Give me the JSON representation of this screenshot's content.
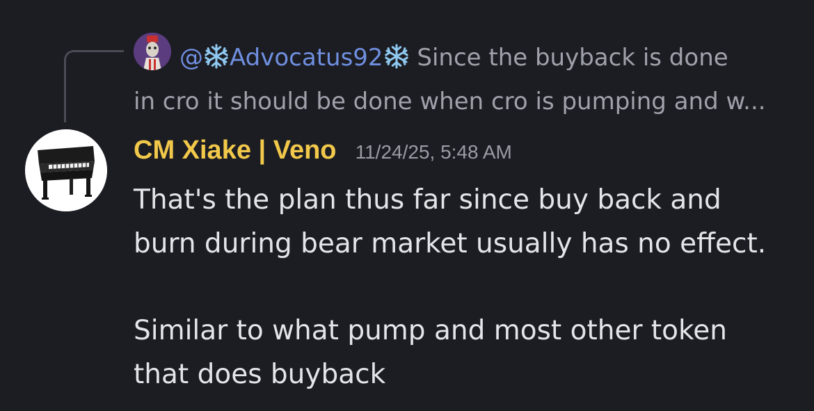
{
  "reply": {
    "mention_prefix": "@",
    "username": "Advocatus92",
    "preview_first": "Since the buyback is done",
    "preview_second": "in cro it should be done when cro is pumping and w..."
  },
  "message": {
    "author": "CM Xiake | Veno",
    "timestamp": "11/24/25, 5:48 AM",
    "paragraph_1_line_1": "That's the plan thus far since buy back and",
    "paragraph_1_line_2": "burn during bear market usually has no effect.",
    "paragraph_2_line_1": "Similar to what pump and most other token",
    "paragraph_2_line_2": "that does buyback"
  },
  "colors": {
    "background": "#1c1d23",
    "author": "#f1c84a",
    "mention": "#6f8fe0",
    "muted": "#a0a2ab",
    "body_text": "#e4e5e9"
  },
  "icons": {
    "reply_avatar": "jester-avatar-icon",
    "author_avatar": "piano-icon",
    "decoration": "snowflake-icon"
  }
}
